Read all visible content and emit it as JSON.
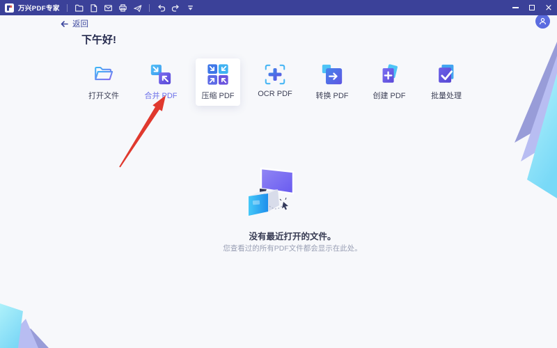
{
  "window": {
    "title": "万兴PDF专家",
    "controls": [
      {
        "name": "minimize"
      },
      {
        "name": "maximize"
      },
      {
        "name": "close"
      }
    ]
  },
  "toolbar": {
    "icons": [
      "folder-open",
      "save-document",
      "email",
      "print",
      "share",
      "undo",
      "redo",
      "collapse-toolbar"
    ]
  },
  "nav": {
    "back_label": "返回"
  },
  "greeting": "下午好!",
  "actions": [
    {
      "label": "打开文件",
      "icon": "open-file-icon"
    },
    {
      "label": "合并 PDF",
      "icon": "merge-pdf-icon",
      "annotated": true
    },
    {
      "label": "压缩 PDF",
      "icon": "compress-pdf-icon",
      "highlighted_card": true
    },
    {
      "label": "OCR PDF",
      "icon": "ocr-pdf-icon"
    },
    {
      "label": "转换 PDF",
      "icon": "convert-pdf-icon"
    },
    {
      "label": "创建 PDF",
      "icon": "create-pdf-icon"
    },
    {
      "label": "批量处理",
      "icon": "batch-process-icon"
    }
  ],
  "empty_state": {
    "title": "没有最近打开的文件。",
    "subtitle": "您查看过的所有PDF文件都会显示在此处。"
  },
  "annotation": {
    "type": "red-arrow",
    "points_to": "合并 PDF",
    "color": "#e0392e"
  },
  "colors": {
    "titlebar": "#3b4199",
    "background": "#f7f8fb",
    "accent_blue": "#45b2f2",
    "accent_purple": "#6a5fe0",
    "arrow_red": "#e0392e",
    "text_primary": "#363a52",
    "text_secondary": "#9aa0b5"
  }
}
